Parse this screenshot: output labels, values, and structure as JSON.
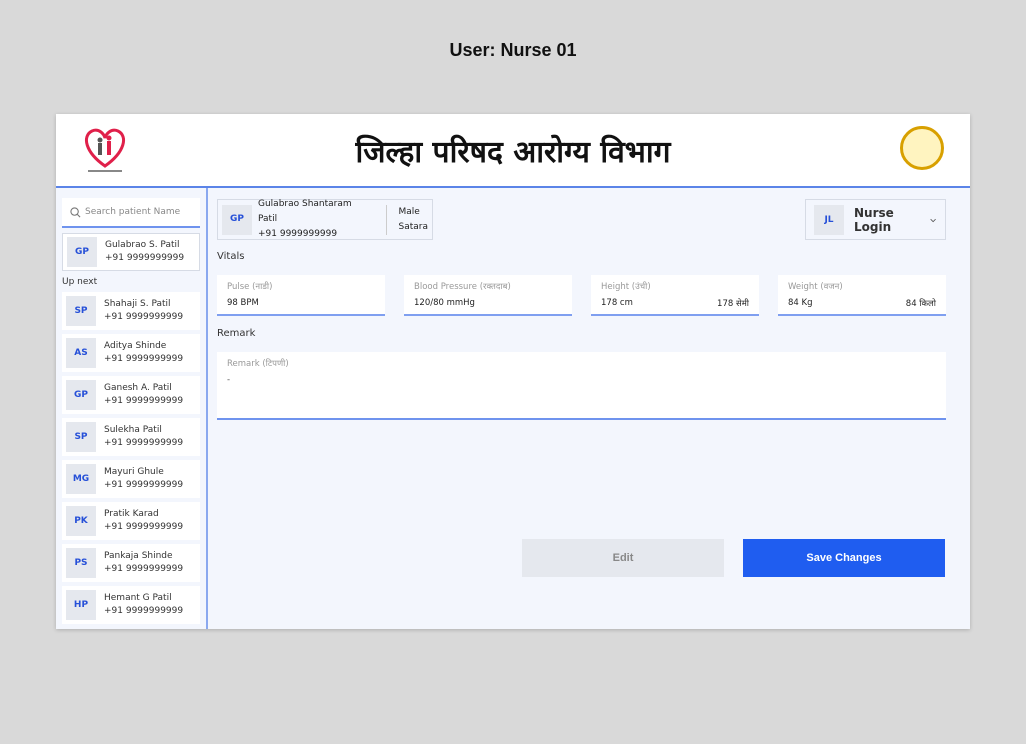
{
  "user_label": "User: Nurse 01",
  "header": {
    "title": "जिल्हा परिषद आरोग्य विभाग"
  },
  "sidebar": {
    "search_placeholder": "Search patient Name",
    "current": {
      "initials": "GP",
      "name": "Gulabrao S. Patil",
      "phone": "+91 9999999999"
    },
    "up_next_label": "Up next",
    "items": [
      {
        "initials": "SP",
        "name": "Shahaji S. Patil",
        "phone": "+91 9999999999"
      },
      {
        "initials": "AS",
        "name": "Aditya Shinde",
        "phone": "+91 9999999999"
      },
      {
        "initials": "GP",
        "name": "Ganesh A. Patil",
        "phone": "+91 9999999999"
      },
      {
        "initials": "SP",
        "name": "Sulekha Patil",
        "phone": "+91 9999999999"
      },
      {
        "initials": "MG",
        "name": "Mayuri Ghule",
        "phone": "+91 9999999999"
      },
      {
        "initials": "PK",
        "name": "Pratik Karad",
        "phone": "+91 9999999999"
      },
      {
        "initials": "PS",
        "name": "Pankaja Shinde",
        "phone": "+91 9999999999"
      },
      {
        "initials": "HP",
        "name": "Hemant G Patil",
        "phone": "+91 9999999999"
      }
    ]
  },
  "patient": {
    "initials": "GP",
    "name": "Gulabrao Shantaram Patil",
    "phone": "+91 9999999999",
    "gender": "Male",
    "location": "Satara"
  },
  "nurse": {
    "initials": "JL",
    "label": "Nurse Login"
  },
  "vitals_label": "Vitals",
  "vitals": [
    {
      "label": "Pulse  (नाडी)",
      "value": "98 BPM",
      "alt": ""
    },
    {
      "label": "Blood Pressure  (रक्तदाब)",
      "value": "120/80 mmHg",
      "alt": ""
    },
    {
      "label": "Height  (उंची)",
      "value": "178 cm",
      "alt": "178 सेमी"
    },
    {
      "label": "Weight  (वजन)",
      "value": "84 Kg",
      "alt": "84 किलो"
    }
  ],
  "remark_label": "Remark",
  "remark": {
    "label": "Remark  (टिपणी)",
    "value": "-"
  },
  "buttons": {
    "edit": "Edit",
    "save": "Save Changes"
  }
}
